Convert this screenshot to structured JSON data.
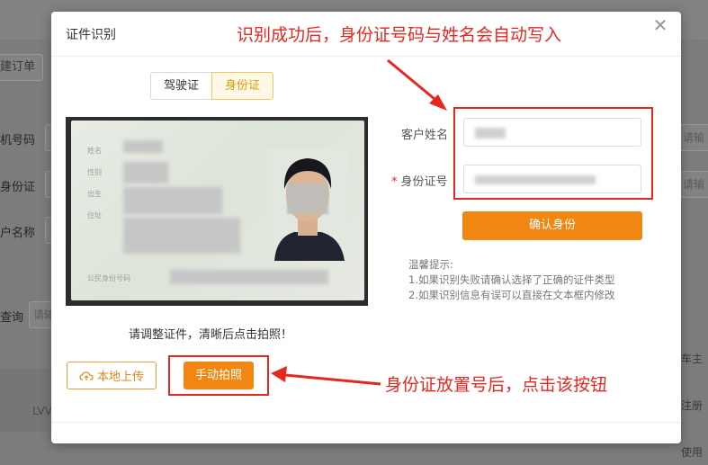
{
  "background": {
    "create_order_label": "建订单",
    "field_labels": [
      "机号码",
      "身份证",
      "户名称"
    ],
    "query_label": "查询",
    "query_placeholder": "请输",
    "right_placeholder": "请输",
    "lvv_text": "LVV",
    "right_texts": [
      "车主",
      "注册",
      "使用"
    ]
  },
  "dialog": {
    "title": "证件识别",
    "close_icon": "close-icon",
    "tabs": [
      {
        "label": "驾驶证",
        "active": false
      },
      {
        "label": "身份证",
        "active": true
      }
    ],
    "photo_hint": "请调整证件，清晰后点击拍照！",
    "upload_label": "本地上传",
    "upload_icon": "cloud-upload-icon",
    "capture_label": "手动拍照",
    "fields": {
      "name_label": "客户姓名",
      "name_value": "",
      "id_label": "身份证号",
      "id_value": "",
      "required_mark": "*"
    },
    "confirm_label": "确认身份",
    "tips_title": "温馨提示:",
    "tips": [
      "1.如果识别失败请确认选择了正确的证件类型",
      "2.如果识别信息有误可以直接在文本框内修改"
    ]
  },
  "annotations": {
    "top": "识别成功后，身份证号码与姓名会自动写入",
    "bottom": "身份证放置号后，点击该按钮",
    "color": "#e6271f"
  },
  "colors": {
    "accent": "#f08713",
    "active_tab_text": "#e69a00",
    "active_tab_border": "#f1c75a"
  },
  "card": {
    "labels": [
      "姓名",
      "性别",
      "出生",
      "住址",
      "公民身份号码"
    ]
  }
}
